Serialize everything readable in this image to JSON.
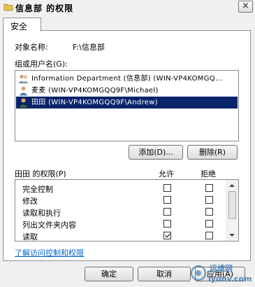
{
  "window": {
    "title": "信息部 的权限",
    "close_glyph": "×"
  },
  "tabs": [
    {
      "label": "安全"
    }
  ],
  "object": {
    "label": "对象名称:",
    "value": "F:\\信息部"
  },
  "groups": {
    "label": "组或用户名(G):",
    "items": [
      {
        "text": "Information Department (信息部) (WIN-VP4KOMGQ...",
        "icon": "group-icon",
        "selected": false
      },
      {
        "text": "麦麦 (WIN-VP4KOMGQQ9F\\Michael)",
        "icon": "user-icon",
        "selected": false
      },
      {
        "text": "田田 (WIN-VP4KOMGQQ9F\\Andrew)",
        "icon": "user-icon",
        "selected": true
      }
    ],
    "add_label": "添加(D)...",
    "remove_label": "删除(R)"
  },
  "permissions": {
    "label": "田田 的权限(P)",
    "allow_header": "允许",
    "deny_header": "拒绝",
    "rows": [
      {
        "name": "完全控制",
        "allow": false,
        "deny": false
      },
      {
        "name": "修改",
        "allow": false,
        "deny": false
      },
      {
        "name": "读取和执行",
        "allow": false,
        "deny": false
      },
      {
        "name": "列出文件夹内容",
        "allow": false,
        "deny": false
      },
      {
        "name": "读取",
        "allow": true,
        "deny": false
      }
    ]
  },
  "link_label": "了解访问控制和权限",
  "footer": {
    "ok_label": "确定",
    "cancel_label": "取消",
    "apply_label": "应用(A)"
  },
  "watermark": {
    "line1": "运维网",
    "line2": "iyunv.com"
  },
  "colors": {
    "selection": "#0a246a",
    "link": "#0066cc",
    "background": "#f0f0f0"
  }
}
